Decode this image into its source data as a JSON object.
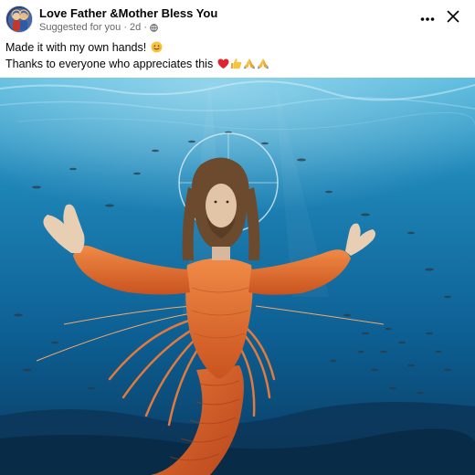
{
  "post": {
    "author": "Love Father &Mother Bless You",
    "meta_text": "Suggested for you · 2d ·",
    "caption_line1": "Made it with my own hands!",
    "caption_line2": "Thanks to everyone who appreciates this"
  },
  "icons": {
    "avatar": "avatar",
    "globe": "globe-icon",
    "more": "more-icon",
    "close": "close-icon",
    "smile": "smile-emoji",
    "heart": "heart-emoji",
    "thumbs_up": "thumbs-up-emoji",
    "pray": "pray-emoji"
  },
  "colors": {
    "text": "#050505",
    "secondary_text": "#65676b",
    "water_top": "#4fb3d9",
    "water_bottom": "#0b3f6a",
    "shrimp_orange": "#e8743a"
  }
}
